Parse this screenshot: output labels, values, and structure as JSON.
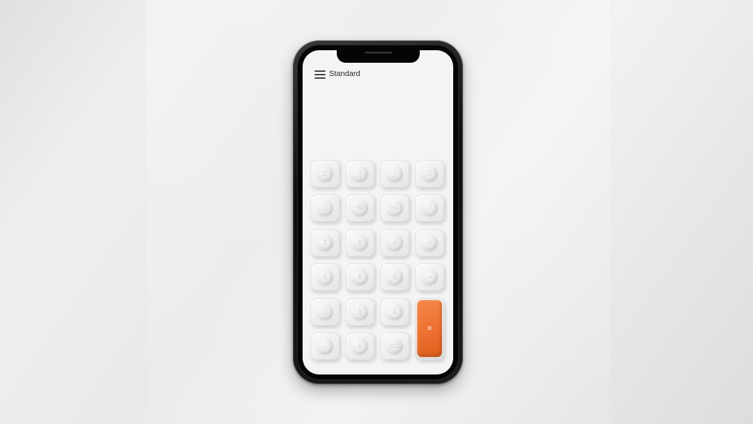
{
  "header": {
    "title": "Standard",
    "menu_icon": "hamburger-menu-icon"
  },
  "display": {
    "expression": "",
    "result": ""
  },
  "keypad": {
    "rows": [
      [
        "C",
        "(",
        ")",
        "X"
      ],
      [
        "1",
        "%",
        "+/-",
        "/"
      ],
      [
        "7",
        "8",
        "9",
        "+"
      ],
      [
        "4",
        "5",
        "6",
        "–"
      ],
      [
        "1",
        "2",
        "3"
      ],
      [
        ".",
        "0",
        "AC"
      ]
    ],
    "equals_label": "=",
    "accent_color": "#ee7031"
  }
}
